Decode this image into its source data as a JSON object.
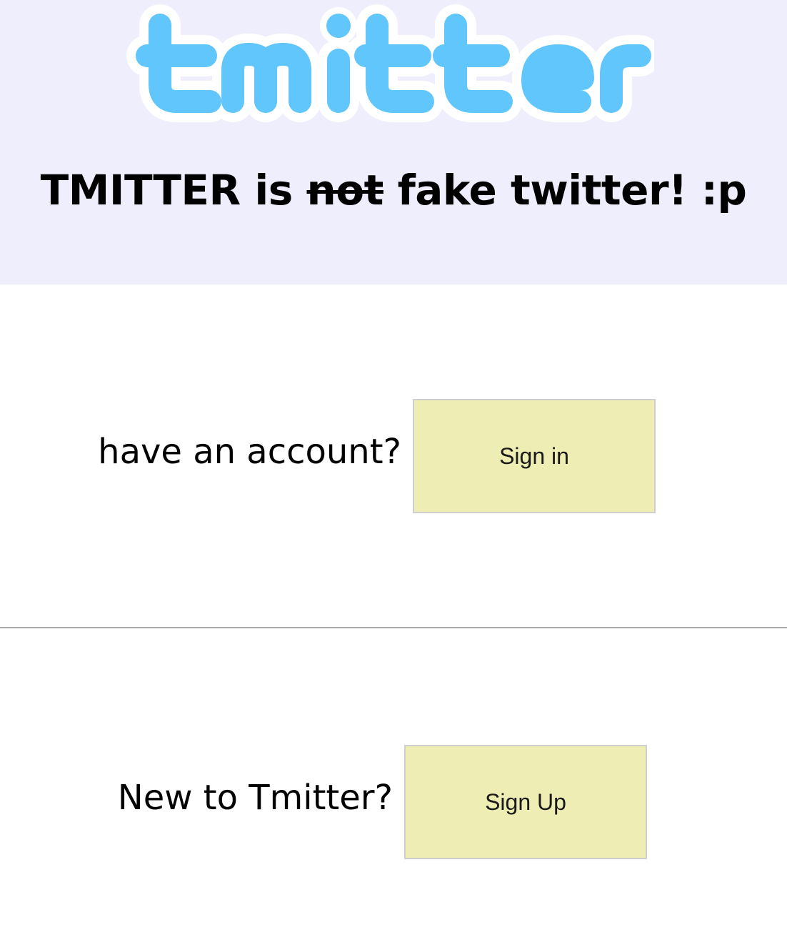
{
  "logo": {
    "text": "tmitter",
    "color": "#61c6fb"
  },
  "header": {
    "tagline_start": "TMITTER is",
    "tagline_struck": "not",
    "tagline_end": "fake twitter! :p",
    "background": "#efeefd"
  },
  "signin": {
    "prompt": "have an account?",
    "button_label": "Sign in"
  },
  "signup": {
    "prompt": "New to Tmitter?",
    "button_label": "Sign Up"
  },
  "colors": {
    "button_bg": "#eeedb3",
    "divider": "#a9a9a9"
  }
}
